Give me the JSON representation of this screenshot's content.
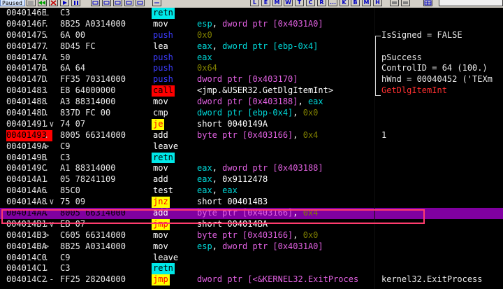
{
  "toolbar": {
    "status": "Paused",
    "letters": [
      "L",
      "E",
      "M",
      "W",
      "T",
      "C",
      "R",
      "...",
      "K",
      "B",
      "M",
      "H"
    ]
  },
  "rows": [
    {
      "addr": "0040146E",
      "mark": "L",
      "hex": "C3",
      "mnem": "retn",
      "mclass": "m-retn",
      "ops": []
    },
    {
      "addr": "0040146F",
      "mark": ".",
      "hex": "8B25 A0314000",
      "mnem": "mov",
      "mclass": "m-normal",
      "ops": [
        {
          "t": "esp",
          "c": "reg"
        },
        {
          "t": ", ",
          "c": "plain"
        },
        {
          "t": "dword ptr [0x4031A0]",
          "c": "ptr"
        }
      ]
    },
    {
      "addr": "00401475",
      "mark": ".",
      "hex": "6A 00",
      "mnem": "push",
      "mclass": "m-push",
      "ops": [
        {
          "t": "0x0",
          "c": "num"
        }
      ],
      "comment": "IsSigned = FALSE"
    },
    {
      "addr": "00401477",
      "mark": ".",
      "hex": "8D45 FC",
      "mnem": "lea",
      "mclass": "m-normal",
      "ops": [
        {
          "t": "eax",
          "c": "reg"
        },
        {
          "t": ", ",
          "c": "plain"
        },
        {
          "t": "dword ptr [ebp-0x4]",
          "c": "reg"
        }
      ]
    },
    {
      "addr": "0040147A",
      "mark": ".",
      "hex": "50",
      "mnem": "push",
      "mclass": "m-push",
      "ops": [
        {
          "t": "eax",
          "c": "reg"
        }
      ],
      "comment": "pSuccess"
    },
    {
      "addr": "0040147B",
      "mark": ".",
      "hex": "6A 64",
      "mnem": "push",
      "mclass": "m-push",
      "ops": [
        {
          "t": "0x64",
          "c": "num"
        }
      ],
      "comment": "ControlID = 64 (100.)"
    },
    {
      "addr": "0040147D",
      "mark": ".",
      "hex": "FF35 70314000",
      "mnem": "push",
      "mclass": "m-push",
      "ops": [
        {
          "t": "dword ptr [0x403170]",
          "c": "ptr"
        }
      ],
      "comment": "hWnd = 00040452 ('TEXm"
    },
    {
      "addr": "00401483",
      "mark": ".",
      "hex": "E8 64000000",
      "mnem": "call",
      "mclass": "m-call",
      "ops": [
        {
          "t": "<jmp.&USER32.GetDlgItemInt>",
          "c": "plain"
        }
      ],
      "comment": "GetDlgItemInt",
      "comment_class": "com-red"
    },
    {
      "addr": "00401488",
      "mark": ".",
      "hex": "A3 88314000",
      "mnem": "mov",
      "mclass": "m-normal",
      "ops": [
        {
          "t": "dword ptr [0x403188]",
          "c": "ptr"
        },
        {
          "t": ", ",
          "c": "plain"
        },
        {
          "t": "eax",
          "c": "reg"
        }
      ]
    },
    {
      "addr": "0040148D",
      "mark": ".",
      "hex": "837D FC 00",
      "mnem": "cmp",
      "mclass": "m-normal",
      "ops": [
        {
          "t": "dword ptr [ebp-0x4]",
          "c": "reg"
        },
        {
          "t": ", ",
          "c": "plain"
        },
        {
          "t": "0x0",
          "c": "num"
        }
      ]
    },
    {
      "addr": "00401491",
      "mark": ".∨",
      "hex": "74 07",
      "mnem": "je",
      "mclass": "m-jmp",
      "ops": [
        {
          "t": "short 0040149A",
          "c": "plain"
        }
      ]
    },
    {
      "addr": "00401493",
      "mark": ".",
      "hex": "8005 66314000",
      "mnem": "add",
      "mclass": "m-normal",
      "ops": [
        {
          "t": "byte ptr [0x403166]",
          "c": "ptr"
        },
        {
          "t": ", ",
          "c": "plain"
        },
        {
          "t": "0x4",
          "c": "num"
        }
      ],
      "comment": "1",
      "bp": true
    },
    {
      "addr": "0040149A",
      "mark": ">",
      "hex": "C9",
      "mnem": "leave",
      "mclass": "m-normal",
      "ops": []
    },
    {
      "addr": "0040149B",
      "mark": ".",
      "hex": "C3",
      "mnem": "retn",
      "mclass": "m-retn",
      "ops": []
    },
    {
      "addr": "0040149C",
      "mark": ".",
      "hex": "A1 88314000",
      "mnem": "mov",
      "mclass": "m-normal",
      "ops": [
        {
          "t": "eax",
          "c": "reg"
        },
        {
          "t": ", ",
          "c": "plain"
        },
        {
          "t": "dword ptr [0x403188]",
          "c": "ptr"
        }
      ]
    },
    {
      "addr": "004014A1",
      "mark": ".",
      "hex": "05 78241109",
      "mnem": "add",
      "mclass": "m-normal",
      "ops": [
        {
          "t": "eax",
          "c": "reg"
        },
        {
          "t": ", ",
          "c": "plain"
        },
        {
          "t": "0x9112478",
          "c": "plain"
        }
      ]
    },
    {
      "addr": "004014A6",
      "mark": ".",
      "hex": "85C0",
      "mnem": "test",
      "mclass": "m-normal",
      "ops": [
        {
          "t": "eax",
          "c": "reg"
        },
        {
          "t": ", ",
          "c": "plain"
        },
        {
          "t": "eax",
          "c": "reg"
        }
      ]
    },
    {
      "addr": "004014A8",
      "mark": ".∨",
      "hex": "75 09",
      "mnem": "jnz",
      "mclass": "m-jmp",
      "ops": [
        {
          "t": "short 004014B3",
          "c": "plain"
        }
      ]
    },
    {
      "addr": "004014AA",
      "mark": ".",
      "hex": "8005 66314000",
      "mnem": "add",
      "mclass": "m-normal",
      "ops": [
        {
          "t": "byte ptr [0x403166]",
          "c": "ptr"
        },
        {
          "t": ", ",
          "c": "plain"
        },
        {
          "t": "0x4",
          "c": "num"
        }
      ],
      "selected": true
    },
    {
      "addr": "004014B1",
      "mark": ".∨",
      "hex": "EB 07",
      "mnem": "jmp",
      "mclass": "m-jmp",
      "ops": [
        {
          "t": "short 004014BA",
          "c": "plain"
        }
      ]
    },
    {
      "addr": "004014B3",
      "mark": ">",
      "hex": "C605 66314000",
      "mnem": "mov",
      "mclass": "m-normal",
      "ops": [
        {
          "t": "byte ptr [0x403166]",
          "c": "ptr"
        },
        {
          "t": ", ",
          "c": "plain"
        },
        {
          "t": "0x0",
          "c": "num"
        }
      ]
    },
    {
      "addr": "004014BA",
      "mark": ">",
      "hex": "8B25 A0314000",
      "mnem": "mov",
      "mclass": "m-normal",
      "ops": [
        {
          "t": "esp",
          "c": "reg"
        },
        {
          "t": ", ",
          "c": "plain"
        },
        {
          "t": "dword ptr [0x4031A0]",
          "c": "ptr"
        }
      ]
    },
    {
      "addr": "004014C0",
      "mark": ".",
      "hex": "C9",
      "mnem": "leave",
      "mclass": "m-normal",
      "ops": []
    },
    {
      "addr": "004014C1",
      "mark": ".",
      "hex": "C3",
      "mnem": "retn",
      "mclass": "m-retn",
      "ops": []
    },
    {
      "addr": "004014C2",
      "mark": ".-",
      "hex": "FF25 28204000",
      "mnem": "jmp",
      "mclass": "m-jmp",
      "ops": [
        {
          "t": "dword ptr [<&KERNEL32.ExitProces",
          "c": "ptr"
        }
      ],
      "comment": "kernel32.ExitProcess"
    }
  ]
}
